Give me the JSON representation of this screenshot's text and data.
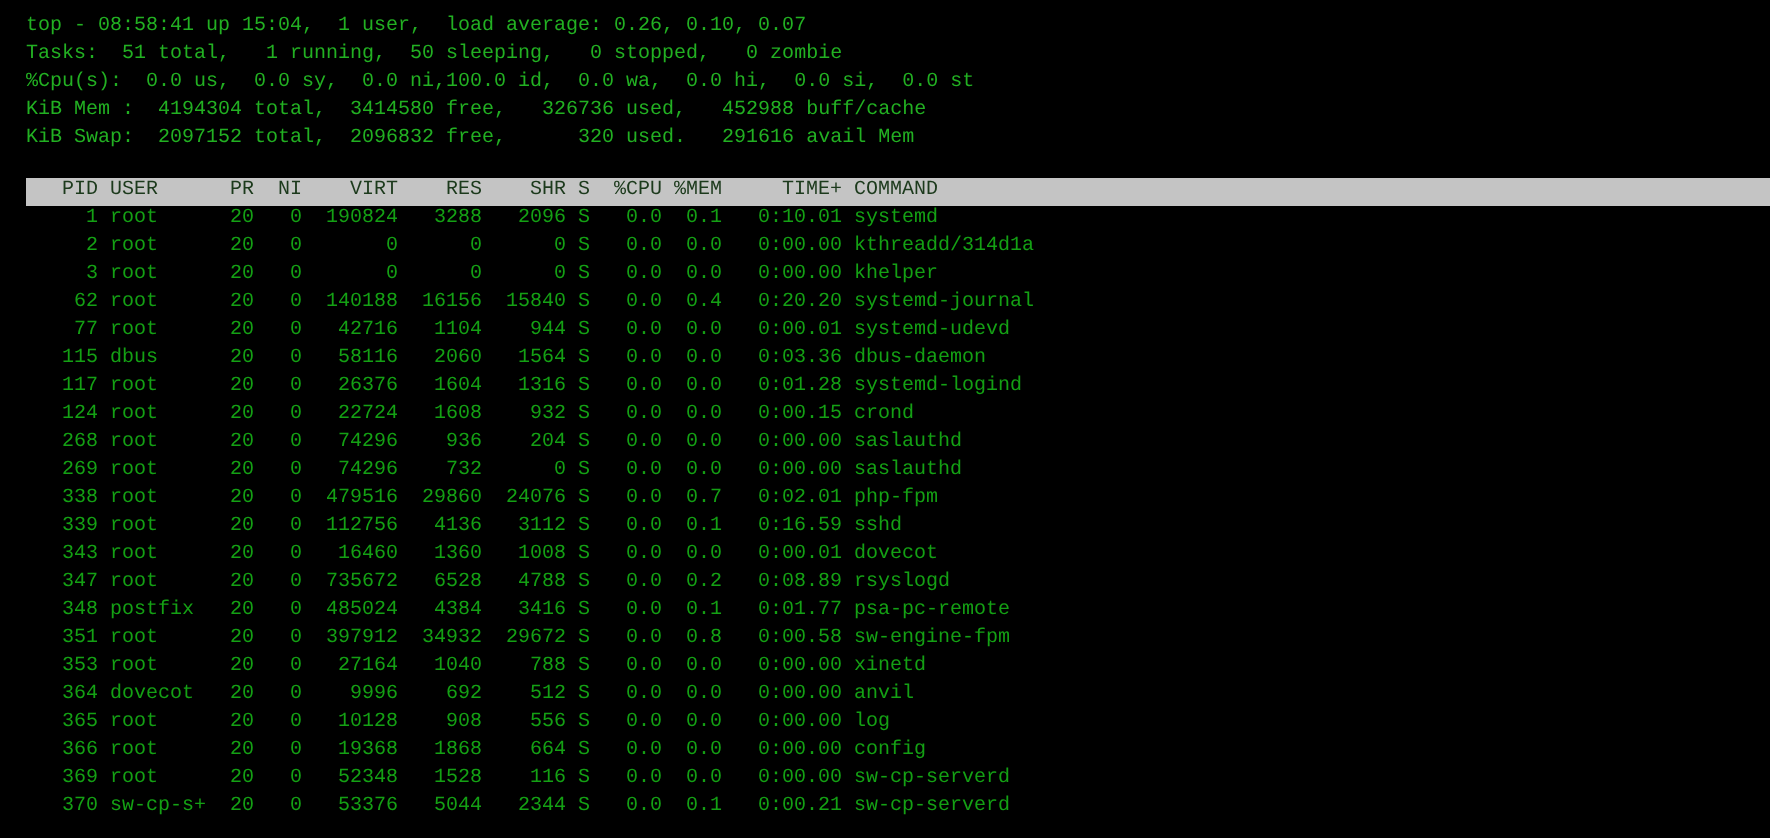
{
  "summary": [
    "top - 08:58:41 up 15:04,  1 user,  load average: 0.26, 0.10, 0.07",
    "Tasks:  51 total,   1 running,  50 sleeping,   0 stopped,   0 zombie",
    "%Cpu(s):  0.0 us,  0.0 sy,  0.0 ni,100.0 id,  0.0 wa,  0.0 hi,  0.0 si,  0.0 st",
    "KiB Mem :  4194304 total,  3414580 free,   326736 used,   452988 buff/cache",
    "KiB Swap:  2097152 total,  2096832 free,      320 used.   291616 avail Mem"
  ],
  "table": {
    "columns": [
      "PID",
      "USER",
      "PR",
      "NI",
      "VIRT",
      "RES",
      "SHR",
      "S",
      "%CPU",
      "%MEM",
      "TIME+",
      "COMMAND"
    ],
    "rows": [
      [
        "1",
        "root",
        "20",
        "0",
        "190824",
        "3288",
        "2096",
        "S",
        "0.0",
        "0.1",
        "0:10.01",
        "systemd"
      ],
      [
        "2",
        "root",
        "20",
        "0",
        "0",
        "0",
        "0",
        "S",
        "0.0",
        "0.0",
        "0:00.00",
        "kthreadd/314d1a"
      ],
      [
        "3",
        "root",
        "20",
        "0",
        "0",
        "0",
        "0",
        "S",
        "0.0",
        "0.0",
        "0:00.00",
        "khelper"
      ],
      [
        "62",
        "root",
        "20",
        "0",
        "140188",
        "16156",
        "15840",
        "S",
        "0.0",
        "0.4",
        "0:20.20",
        "systemd-journal"
      ],
      [
        "77",
        "root",
        "20",
        "0",
        "42716",
        "1104",
        "944",
        "S",
        "0.0",
        "0.0",
        "0:00.01",
        "systemd-udevd"
      ],
      [
        "115",
        "dbus",
        "20",
        "0",
        "58116",
        "2060",
        "1564",
        "S",
        "0.0",
        "0.0",
        "0:03.36",
        "dbus-daemon"
      ],
      [
        "117",
        "root",
        "20",
        "0",
        "26376",
        "1604",
        "1316",
        "S",
        "0.0",
        "0.0",
        "0:01.28",
        "systemd-logind"
      ],
      [
        "124",
        "root",
        "20",
        "0",
        "22724",
        "1608",
        "932",
        "S",
        "0.0",
        "0.0",
        "0:00.15",
        "crond"
      ],
      [
        "268",
        "root",
        "20",
        "0",
        "74296",
        "936",
        "204",
        "S",
        "0.0",
        "0.0",
        "0:00.00",
        "saslauthd"
      ],
      [
        "269",
        "root",
        "20",
        "0",
        "74296",
        "732",
        "0",
        "S",
        "0.0",
        "0.0",
        "0:00.00",
        "saslauthd"
      ],
      [
        "338",
        "root",
        "20",
        "0",
        "479516",
        "29860",
        "24076",
        "S",
        "0.0",
        "0.7",
        "0:02.01",
        "php-fpm"
      ],
      [
        "339",
        "root",
        "20",
        "0",
        "112756",
        "4136",
        "3112",
        "S",
        "0.0",
        "0.1",
        "0:16.59",
        "sshd"
      ],
      [
        "343",
        "root",
        "20",
        "0",
        "16460",
        "1360",
        "1008",
        "S",
        "0.0",
        "0.0",
        "0:00.01",
        "dovecot"
      ],
      [
        "347",
        "root",
        "20",
        "0",
        "735672",
        "6528",
        "4788",
        "S",
        "0.0",
        "0.2",
        "0:08.89",
        "rsyslogd"
      ],
      [
        "348",
        "postfix",
        "20",
        "0",
        "485024",
        "4384",
        "3416",
        "S",
        "0.0",
        "0.1",
        "0:01.77",
        "psa-pc-remote"
      ],
      [
        "351",
        "root",
        "20",
        "0",
        "397912",
        "34932",
        "29672",
        "S",
        "0.0",
        "0.8",
        "0:00.58",
        "sw-engine-fpm"
      ],
      [
        "353",
        "root",
        "20",
        "0",
        "27164",
        "1040",
        "788",
        "S",
        "0.0",
        "0.0",
        "0:00.00",
        "xinetd"
      ],
      [
        "364",
        "dovecot",
        "20",
        "0",
        "9996",
        "692",
        "512",
        "S",
        "0.0",
        "0.0",
        "0:00.00",
        "anvil"
      ],
      [
        "365",
        "root",
        "20",
        "0",
        "10128",
        "908",
        "556",
        "S",
        "0.0",
        "0.0",
        "0:00.00",
        "log"
      ],
      [
        "366",
        "root",
        "20",
        "0",
        "19368",
        "1868",
        "664",
        "S",
        "0.0",
        "0.0",
        "0:00.00",
        "config"
      ],
      [
        "369",
        "root",
        "20",
        "0",
        "52348",
        "1528",
        "116",
        "S",
        "0.0",
        "0.0",
        "0:00.00",
        "sw-cp-serverd"
      ],
      [
        "370",
        "sw-cp-s+",
        "20",
        "0",
        "53376",
        "5044",
        "2344",
        "S",
        "0.0",
        "0.1",
        "0:00.21",
        "sw-cp-serverd"
      ]
    ]
  }
}
